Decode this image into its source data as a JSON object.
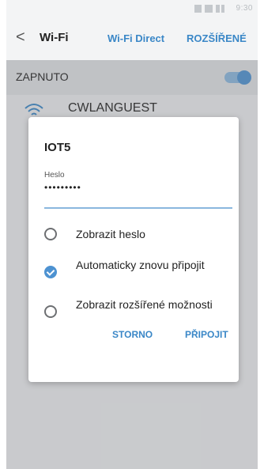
{
  "status_bar": {
    "time": "9:30"
  },
  "header": {
    "back_label": "<",
    "title": "Wi-Fi",
    "tab_direct": "Wi-Fi Direct",
    "tab_advanced": "ROZŠÍŘENÉ"
  },
  "switch_row": {
    "label": "ZAPNUTO",
    "state": "on"
  },
  "network": {
    "name": "CWLANGUEST"
  },
  "dialog": {
    "title": "IOT5",
    "password_label": "Heslo",
    "password_value": "•••••••••",
    "options": [
      {
        "label": "Zobrazit heslo",
        "checked": false
      },
      {
        "label": "Automaticky znovu připojit",
        "checked": true
      },
      {
        "label": "Zobrazit rozšířené možnosti",
        "checked": false
      }
    ],
    "cancel_label": "STORNO",
    "connect_label": "PŘIPOJIT"
  },
  "colors": {
    "accent": "#3a87c7",
    "check": "#4d92d1"
  }
}
